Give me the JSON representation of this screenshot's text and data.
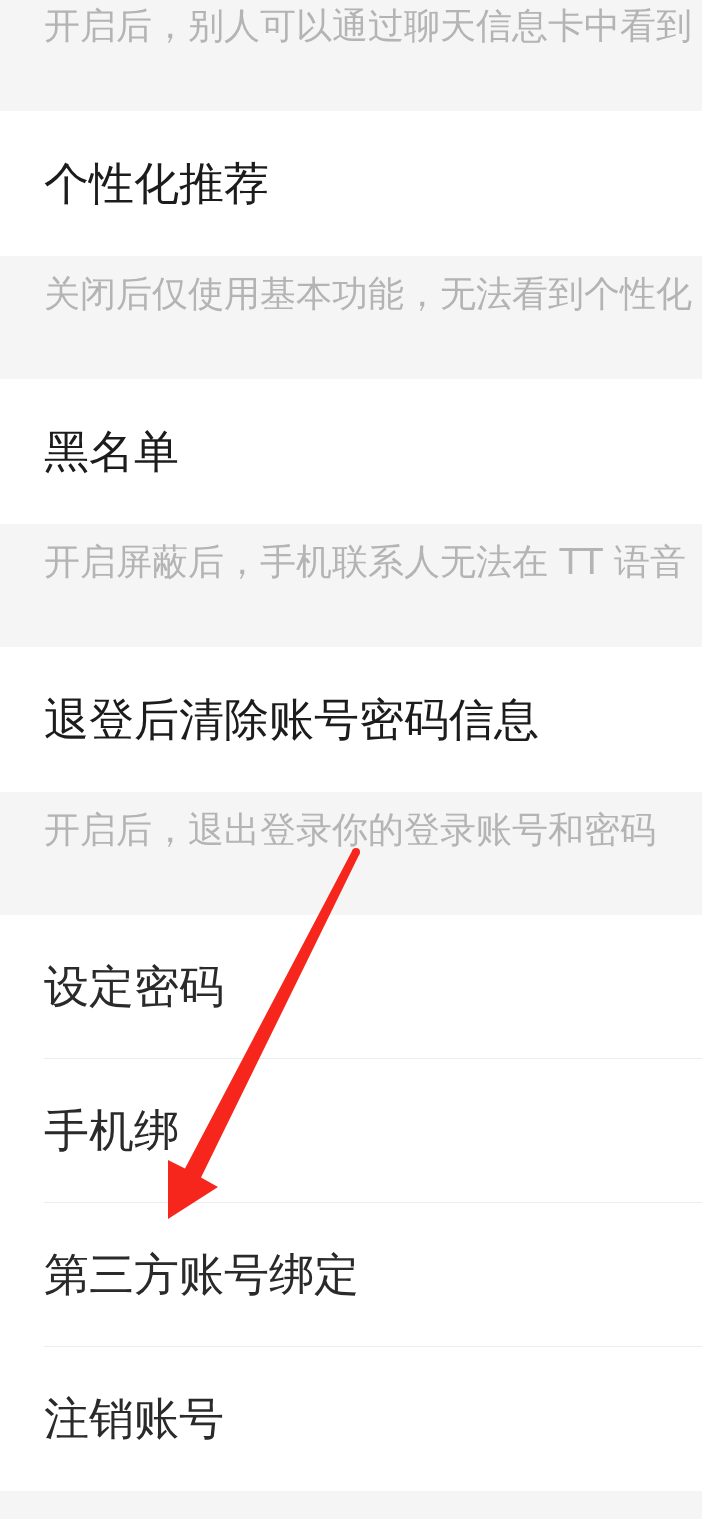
{
  "items": [
    {
      "kind": "note",
      "text": "开启后，别人可以通过聊天信息卡中看到"
    },
    {
      "kind": "setting",
      "label": "个性化推荐"
    },
    {
      "kind": "note",
      "text": "关闭后仅使用基本功能，无法看到个性化"
    },
    {
      "kind": "setting",
      "label": "黑名单"
    },
    {
      "kind": "note",
      "text": "开启屏蔽后，手机联系人无法在 TT 语音"
    },
    {
      "kind": "setting",
      "label": "退登后清除账号密码信息"
    },
    {
      "kind": "note",
      "text": "开启后，退出登录你的登录账号和密码"
    },
    {
      "kind": "menu",
      "rows": [
        {
          "label": "设定密码"
        },
        {
          "label": "手机绑"
        },
        {
          "label": "第三方账号绑定"
        },
        {
          "label": "注销账号"
        }
      ]
    }
  ],
  "annotations": [
    {
      "kind": "arrow"
    }
  ]
}
